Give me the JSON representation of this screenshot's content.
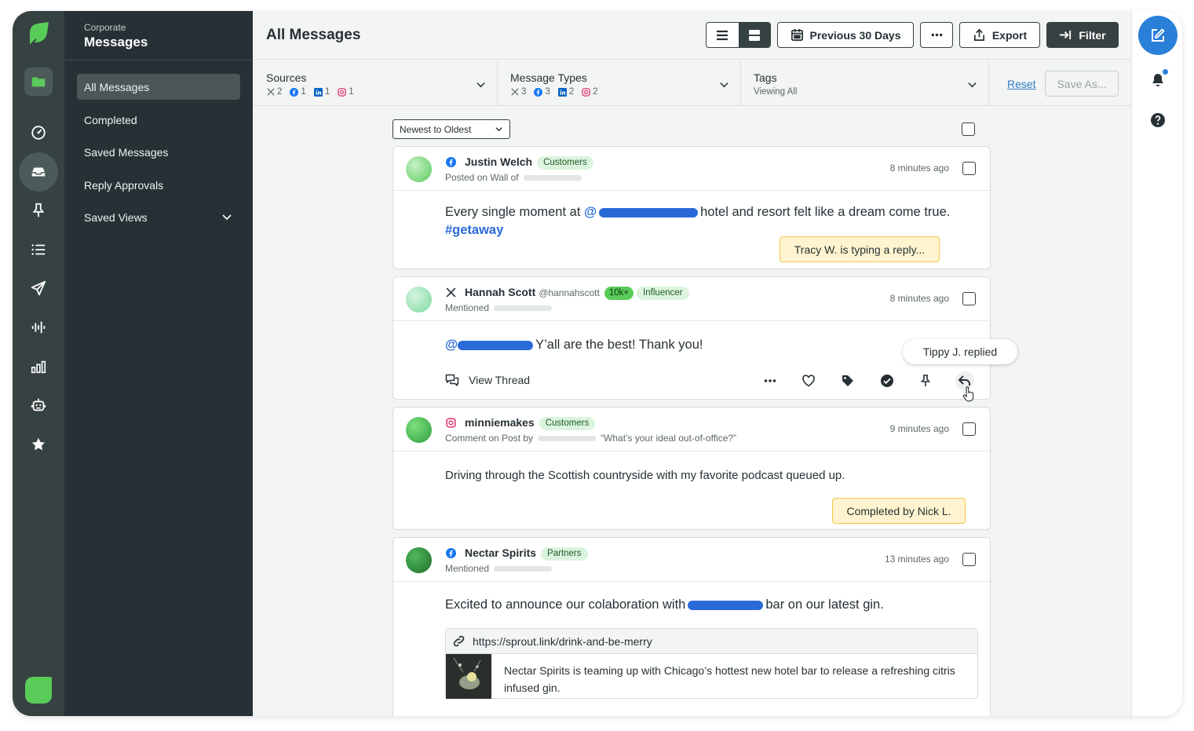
{
  "app": {
    "section": "Corporate",
    "title": "Messages"
  },
  "nav": {
    "items": [
      {
        "label": "All Messages",
        "active": true
      },
      {
        "label": "Completed"
      },
      {
        "label": "Saved Messages"
      },
      {
        "label": "Reply Approvals"
      },
      {
        "label": "Saved Views"
      }
    ]
  },
  "rail": {
    "icons": [
      "folder-icon",
      "dashboard-icon",
      "inbox-icon",
      "pin-icon",
      "list-icon",
      "send-icon",
      "audio-listening-icon",
      "reports-icon",
      "bot-icon",
      "star-icon"
    ]
  },
  "header": {
    "title": "All Messages",
    "date_range": "Previous 30 Days",
    "export_label": "Export",
    "filter_label": "Filter"
  },
  "filters": {
    "sources": {
      "label": "Sources",
      "counts": {
        "x": "2",
        "facebook": "1",
        "linkedin": "1",
        "instagram": "1"
      }
    },
    "types": {
      "label": "Message Types",
      "counts": {
        "x": "3",
        "facebook": "3",
        "linkedin": "2",
        "instagram": "2"
      }
    },
    "tags": {
      "label": "Tags",
      "value": "Viewing All"
    },
    "reset_label": "Reset",
    "save_as_label": "Save As..."
  },
  "sort": {
    "value": "Newest to Oldest"
  },
  "messages": [
    {
      "network": "facebook",
      "name": "Justin Welch",
      "handle": "",
      "tags": [
        "Customers"
      ],
      "meta": "Posted on Wall of",
      "time": "8 minutes ago",
      "text_before": "Every single moment at ",
      "text_at": "@",
      "text_after": "hotel and resort felt like a dream come true.",
      "hashtag": "#getaway",
      "notice": "Tracy W. is typing a reply..."
    },
    {
      "network": "x",
      "name": "Hannah Scott",
      "handle": "@hannahscott",
      "tags": [
        "10k+",
        "Influencer"
      ],
      "meta": "Mentioned",
      "time": "8 minutes ago",
      "text_at": "@",
      "text_after": "Y’all are the best! Thank you!",
      "view_thread": "View Thread",
      "tooltip": "Tippy J. replied"
    },
    {
      "network": "instagram",
      "name": "minniemakes",
      "tags": [
        "Customers"
      ],
      "meta": "Comment on Post by",
      "meta_quote": "“What’s your ideal out-of-office?”",
      "time": "9 minutes ago",
      "text": "Driving through the Scottish countryside with my favorite podcast queued up.",
      "notice": "Completed by Nick L."
    },
    {
      "network": "facebook",
      "name": "Nectar Spirits",
      "tags": [
        "Partners"
      ],
      "meta": "Mentioned",
      "time": "13 minutes ago",
      "text_before": "Excited to announce our colaboration with",
      "text_after": "bar on our latest gin.",
      "link_url": "https://sprout.link/drink-and-be-merry",
      "link_desc": "Nectar Spirits is teaming up with Chicago’s hottest new hotel bar to release a refreshing citris infused gin."
    }
  ],
  "colors": {
    "rail": "#364141",
    "nav": "#273135",
    "accent_green": "#59cb59",
    "accent_blue": "#2a7fd8",
    "notice_yellow": "#fff4cf"
  }
}
